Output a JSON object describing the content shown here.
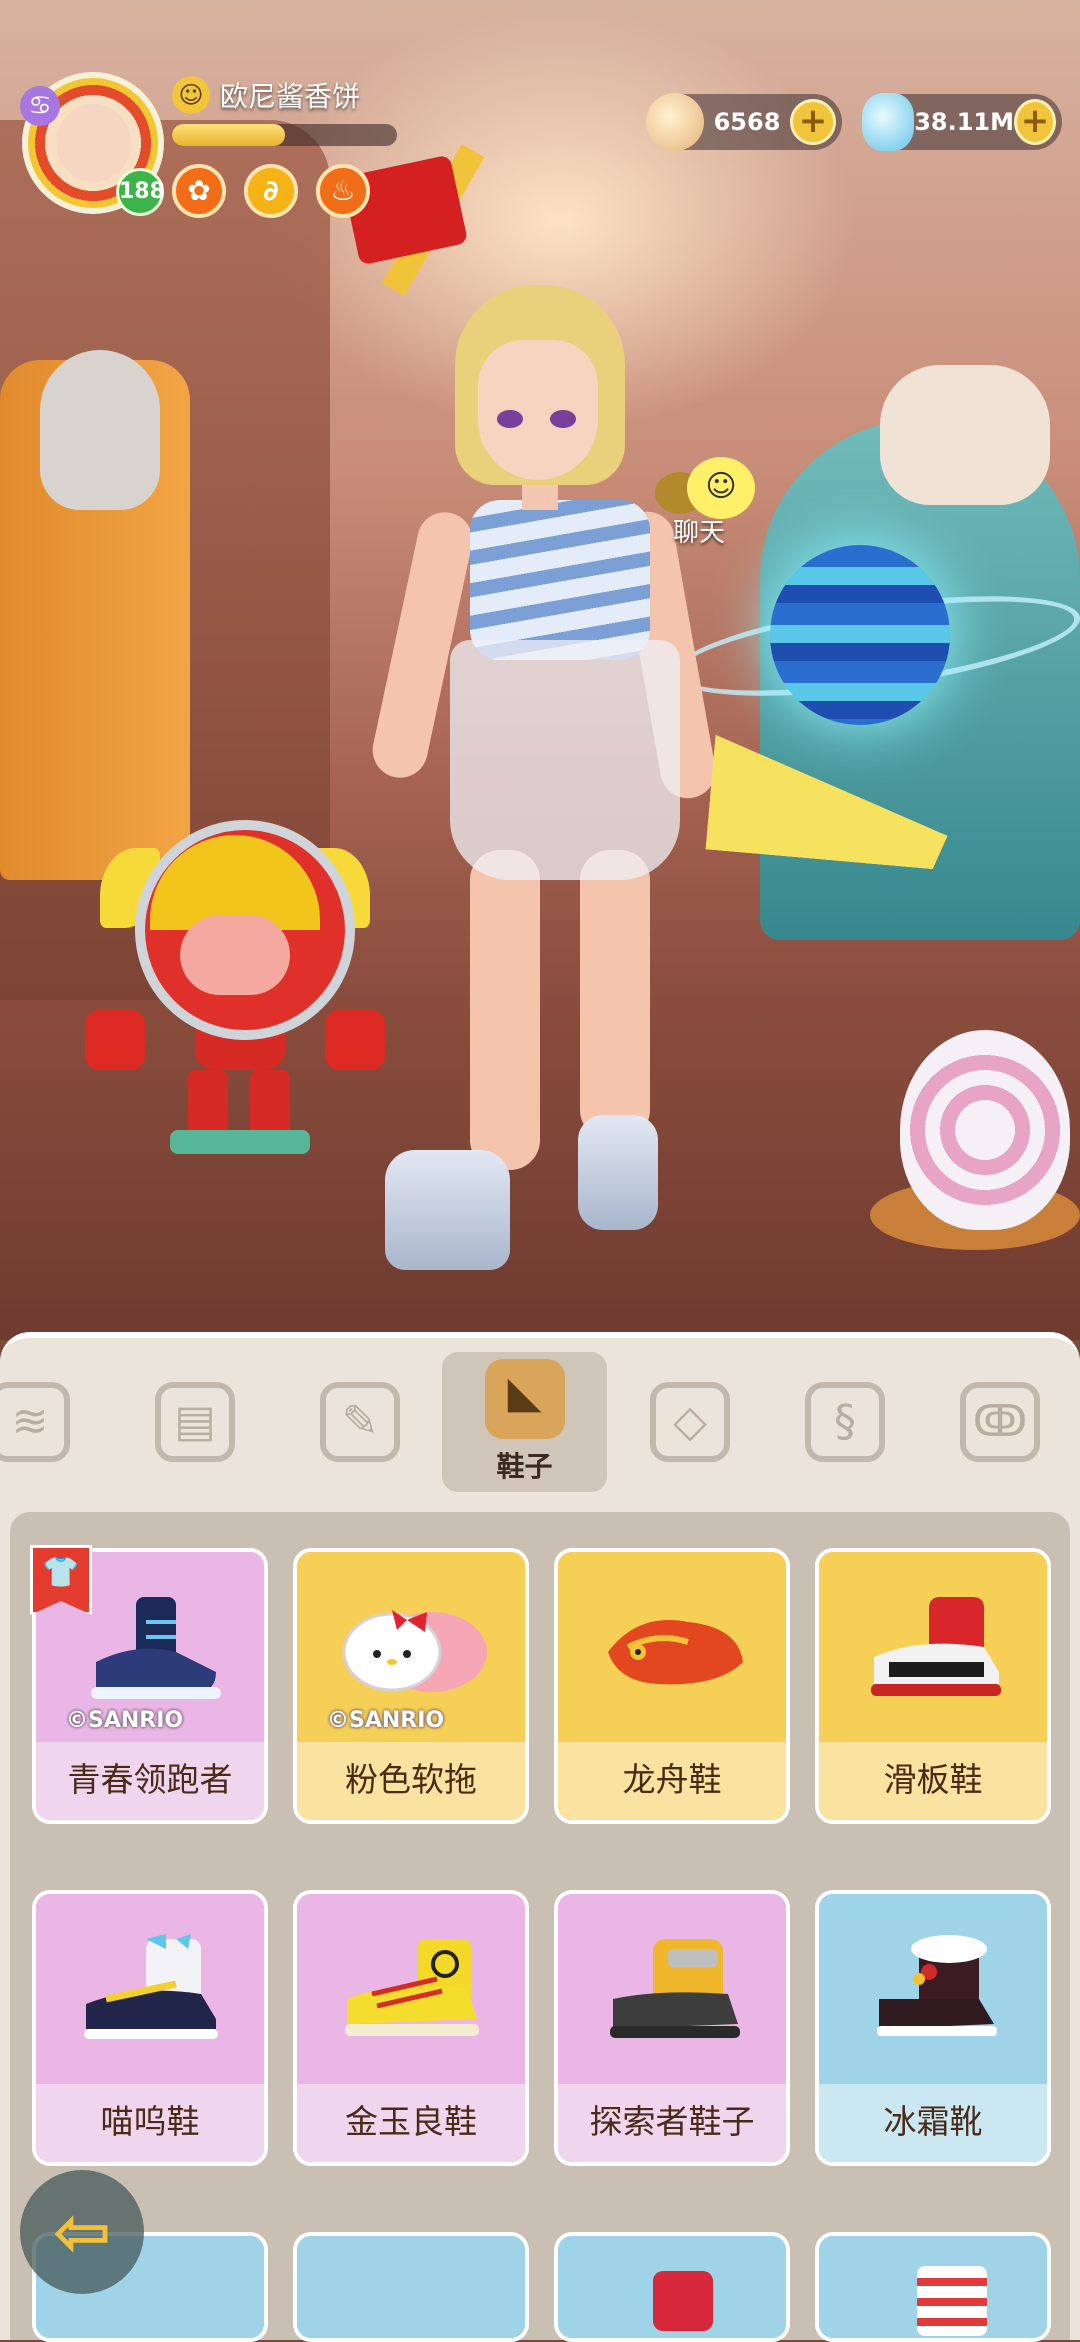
{
  "player": {
    "name": "欧尼酱香饼",
    "level": "188",
    "exp_fraction": 0.5
  },
  "currency": {
    "shells": "6568",
    "gems": "38.11M",
    "add_symbol": "+"
  },
  "chat": {
    "label": "聊天"
  },
  "categories": {
    "active_label": "鞋子"
  },
  "items": [
    {
      "name": "青春领跑者",
      "rarity": "purple",
      "copyright": "©SANRIO"
    },
    {
      "name": "粉色软拖",
      "rarity": "gold",
      "copyright": "©SANRIO"
    },
    {
      "name": "龙舟鞋",
      "rarity": "gold"
    },
    {
      "name": "滑板鞋",
      "rarity": "gold"
    },
    {
      "name": "喵呜鞋",
      "rarity": "purple"
    },
    {
      "name": "金玉良鞋",
      "rarity": "purple"
    },
    {
      "name": "探索者鞋子",
      "rarity": "purple"
    },
    {
      "name": "冰霜靴",
      "rarity": "blue"
    }
  ],
  "colors": {
    "purple": "#e5a6df",
    "gold": "#f4c346",
    "blue": "#8cc9e2"
  }
}
